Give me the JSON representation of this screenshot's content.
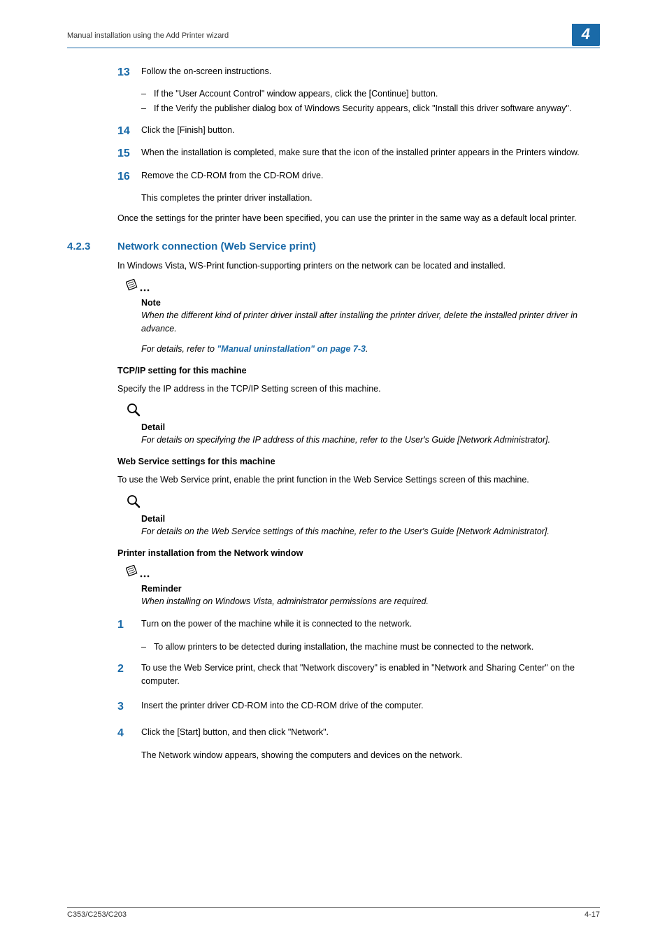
{
  "header": {
    "breadcrumb": "Manual installation using the Add Printer wizard",
    "chapter": "4"
  },
  "steps1": {
    "s13": {
      "num": "13",
      "text": "Follow the on-screen instructions.",
      "bullets": [
        "If the \"User Account Control\" window appears, click the [Continue] button.",
        "If the Verify the publisher dialog box of Windows Security appears, click \"Install this driver software anyway\"."
      ]
    },
    "s14": {
      "num": "14",
      "text": "Click the [Finish] button."
    },
    "s15": {
      "num": "15",
      "text": "When the installation is completed, make sure that the icon of the installed printer appears in the Printers window."
    },
    "s16": {
      "num": "16",
      "text": "Remove the CD-ROM from the CD-ROM drive.",
      "extra": "This completes the printer driver installation."
    },
    "summary": "Once the settings for the printer have been specified, you can use the printer in the same way as a default local printer."
  },
  "section": {
    "num": "4.2.3",
    "title": "Network connection (Web Service print)",
    "intro": "In Windows Vista, WS-Print function-supporting printers on the network can be located and installed."
  },
  "note": {
    "label": "Note",
    "body1": "When the different kind of printer driver install after installing the printer driver, delete the installed printer driver in advance.",
    "body2_prefix": "For details, refer to ",
    "body2_link": "\"Manual uninstallation\" on page 7-3",
    "body2_suffix": "."
  },
  "tcpip": {
    "heading": "TCP/IP setting for this machine",
    "para": "Specify the IP address in the TCP/IP Setting screen of this machine.",
    "detail_label": "Detail",
    "detail_body": "For details on specifying the IP address of this machine, refer to the User's Guide [Network Administrator]."
  },
  "webservice": {
    "heading": "Web Service settings for this machine",
    "para": "To use the Web Service print, enable the print function in the Web Service Settings screen of this machine.",
    "detail_label": "Detail",
    "detail_body": "For details on the Web Service settings of this machine, refer to the User's Guide [Network Administrator]."
  },
  "install": {
    "heading": "Printer installation from the Network window",
    "reminder_label": "Reminder",
    "reminder_body": "When installing on Windows Vista, administrator permissions are required.",
    "steps": {
      "s1": {
        "num": "1",
        "text": "Turn on the power of the machine while it is connected to the network.",
        "bullets": [
          "To allow printers to be detected during installation, the machine must be connected to the network."
        ]
      },
      "s2": {
        "num": "2",
        "text": "To use the Web Service print, check that \"Network discovery\" is enabled in \"Network and Sharing Center\" on the computer."
      },
      "s3": {
        "num": "3",
        "text": "Insert the printer driver CD-ROM into the CD-ROM drive of the computer."
      },
      "s4": {
        "num": "4",
        "text": "Click the [Start] button, and then click \"Network\".",
        "extra": "The Network window appears, showing the computers and devices on the network."
      }
    }
  },
  "footer": {
    "left": "C353/C253/C203",
    "right": "4-17"
  }
}
